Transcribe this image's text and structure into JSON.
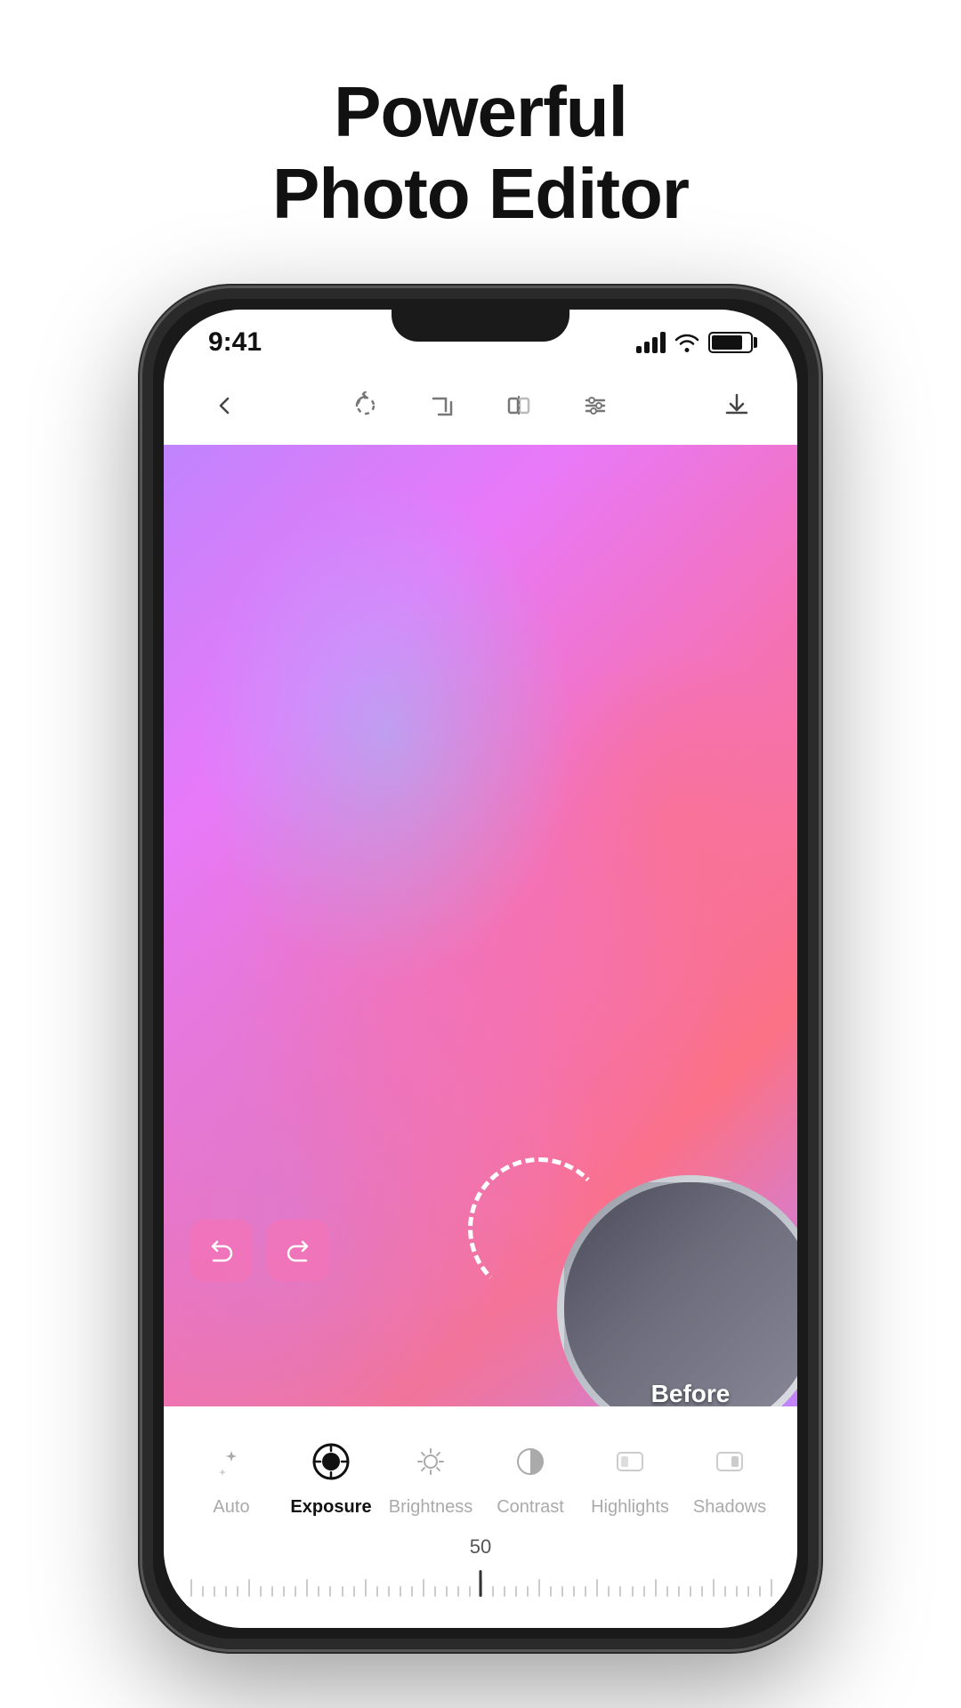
{
  "page": {
    "title_line1": "Powerful",
    "title_line2": "Photo Editor"
  },
  "status_bar": {
    "time": "9:41"
  },
  "toolbar": {
    "back_label": "back",
    "rotate_label": "rotate",
    "crop_label": "crop",
    "flip_label": "flip",
    "adjust_label": "adjust",
    "download_label": "download"
  },
  "edit_tools": [
    {
      "id": "auto",
      "label": "Auto",
      "active": false
    },
    {
      "id": "exposure",
      "label": "Exposure",
      "active": true
    },
    {
      "id": "brightness",
      "label": "Brightness",
      "active": false
    },
    {
      "id": "contrast",
      "label": "Contrast",
      "active": false
    },
    {
      "id": "highlights",
      "label": "Highlights",
      "active": false
    },
    {
      "id": "shadows",
      "label": "Shadows",
      "active": false
    }
  ],
  "slider": {
    "value": "50",
    "min": "-100",
    "max": "100"
  },
  "before_label": "Before",
  "colors": {
    "accent": "#ec4899",
    "active_tool": "#111111",
    "inactive_tool": "#aaaaaa"
  }
}
